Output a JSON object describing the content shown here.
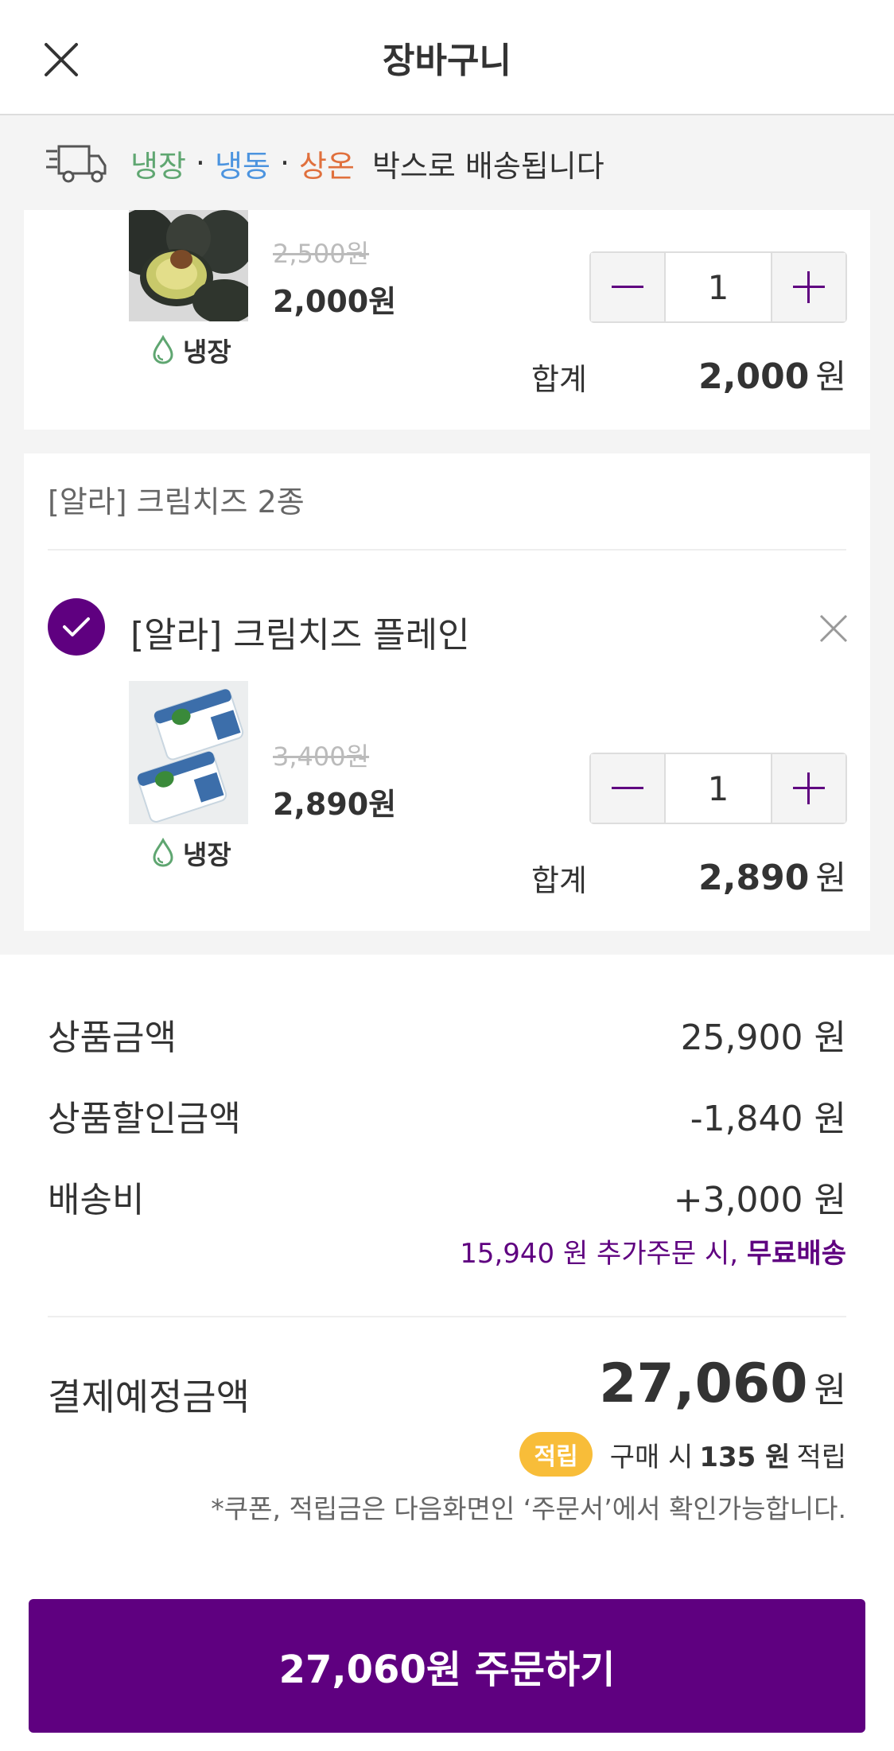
{
  "header": {
    "title": "장바구니"
  },
  "banner": {
    "cold": "냉장",
    "frozen": "냉동",
    "room": "상온",
    "sep": "·",
    "text": "박스로 배송됩니다"
  },
  "item1": {
    "original_price": "2,500원",
    "price": "2,000원",
    "storage": "냉장",
    "quantity": "1",
    "sum_label": "합계",
    "sum_value": "2,000",
    "sum_unit": "원"
  },
  "group2": {
    "title": "[알라] 크림치즈 2종",
    "item": {
      "name": "[알라] 크림치즈 플레인",
      "original_price": "3,400원",
      "price": "2,890원",
      "storage": "냉장",
      "quantity": "1",
      "sum_label": "합계",
      "sum_value": "2,890",
      "sum_unit": "원"
    }
  },
  "summary": {
    "product_amount_label": "상품금액",
    "product_amount_value": "25,900 원",
    "discount_label": "상품할인금액",
    "discount_value": "-1,840 원",
    "shipping_label": "배송비",
    "shipping_value": "+3,000 원",
    "free_ship_prefix": "15,940 원 추가주문 시, ",
    "free_ship_strong": "무료배송",
    "total_label": "결제예정금액",
    "total_value": "27,060",
    "total_unit": "원",
    "points_badge": "적립",
    "points_prefix": "구매 시",
    "points_amount": "135 원",
    "points_suffix": "적립",
    "notice": "*쿠폰, 적립금은 다음화면인 ‘주문서’에서 확인가능합니다."
  },
  "order_button": {
    "label": "27,060원 주문하기"
  },
  "colors": {
    "primary": "#5f0080",
    "cold": "#5fa671",
    "frozen": "#4c94df",
    "room": "#e0703d",
    "badge": "#f8bd39"
  }
}
